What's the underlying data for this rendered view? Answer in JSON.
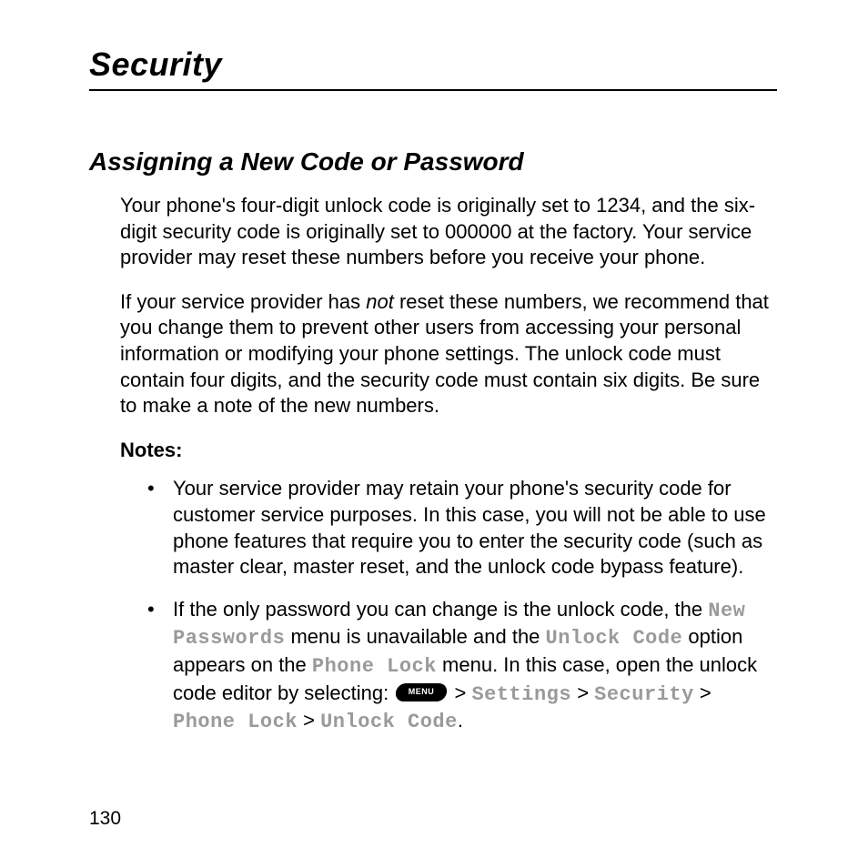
{
  "chapter_title": "Security",
  "section_title": "Assigning a New Code or Password",
  "para1": "Your phone's four-digit unlock code is originally set to 1234, and the six-digit security code is originally set to 000000 at the factory. Your service provider may reset these numbers before you receive your phone.",
  "para2_a": "If your service provider has ",
  "para2_not": "not",
  "para2_b": " reset these numbers, we recommend that you change them to prevent other users from accessing your personal information or modifying your phone settings. The unlock code must contain four digits, and the security code must contain six digits. Be sure to make a note of the new numbers.",
  "notes_label": "Notes:",
  "note1": "Your service provider may retain your phone's security code for customer service purposes. In this case, you will not be able to use phone features that require you to enter the security code (such as master clear, master reset, and the unlock code bypass feature).",
  "note2": {
    "a": "If the only password you can change is the unlock code, the ",
    "new_passwords": "New Passwords",
    "b": " menu is unavailable and the ",
    "unlock_code": "Unlock Code",
    "c": " option appears on the ",
    "phone_lock": "Phone Lock",
    "d": " menu. In this case, open the unlock code editor by selecting: ",
    "menu_key": "MENU",
    "gt1": " > ",
    "settings": "Settings",
    "gt2": " > ",
    "security": "Security",
    "gt3": " > ",
    "phone_lock2": "Phone Lock",
    "gt4": " > ",
    "unlock_code2": "Unlock Code",
    "period": "."
  },
  "page_number": "130"
}
